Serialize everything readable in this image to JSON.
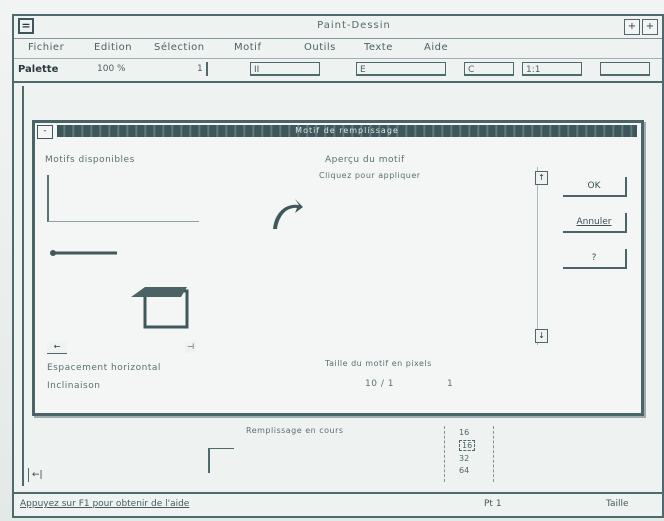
{
  "window": {
    "title": "Paint-Dessin",
    "minimize_label": "+",
    "maximize_label": "+",
    "system_menu_label": "="
  },
  "menubar": {
    "items": [
      "Fichier",
      "Edition",
      "Sélection",
      "Motif",
      "Outils",
      "Texte",
      "Aide"
    ]
  },
  "toolbar": {
    "label": "Palette",
    "fields": [
      "100 %",
      "1",
      "II",
      "E",
      "C",
      "1:1"
    ]
  },
  "dialog": {
    "title": "Motif de remplissage",
    "system_label": "-",
    "list_label": "Motifs disponibles",
    "preview_label": "Aperçu du motif",
    "preview_sub": "Cliquez pour appliquer",
    "ok_label": "OK",
    "cancel_label": "Annuler",
    "help_label": "?",
    "scroll_up": "↑",
    "scroll_down": "↓",
    "left_scroll_label": "←",
    "option_1": "Espacement horizontal",
    "option_2": "Inclinaison",
    "footer_text": "Taille du motif en pixels",
    "footer_value": "10 / 1",
    "footer_value2": "1"
  },
  "canvas_caption": "Remplissage en cours",
  "pattern_column": [
    "16",
    "16",
    "32",
    "64"
  ],
  "statusbar": {
    "left": "Appuyez sur F1 pour obtenir de l'aide",
    "middle": "Pt 1",
    "right": "Taille"
  }
}
